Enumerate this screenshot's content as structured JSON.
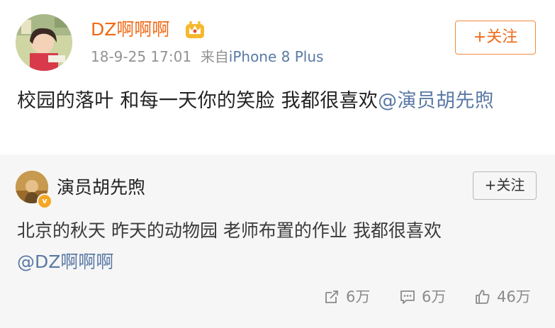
{
  "post": {
    "username": "DZ啊啊啊",
    "badge_icon": "crown-vip-icon",
    "time": "18-9-25 17:01",
    "source_prefix": "来自",
    "source": "iPhone 8 Plus",
    "follow_label": "+关注",
    "text": "校园的落叶 和每一天你的笑脸 我都很喜欢",
    "mention": "@演员胡先煦"
  },
  "repost": {
    "username": "演员胡先煦",
    "verified_badge": "v",
    "follow_label": "+关注",
    "text": "北京的秋天 昨天的动物园 老师布置的作业 我都很喜欢",
    "mention": "@DZ啊啊啊",
    "actions": {
      "repost_count": "6万",
      "comment_count": "6万",
      "like_count": "46万"
    }
  },
  "colors": {
    "accent_orange": "#f06a16",
    "link_blue": "#5a79a5",
    "meta_gray": "#939393",
    "repost_bg": "#f6f6f6"
  }
}
